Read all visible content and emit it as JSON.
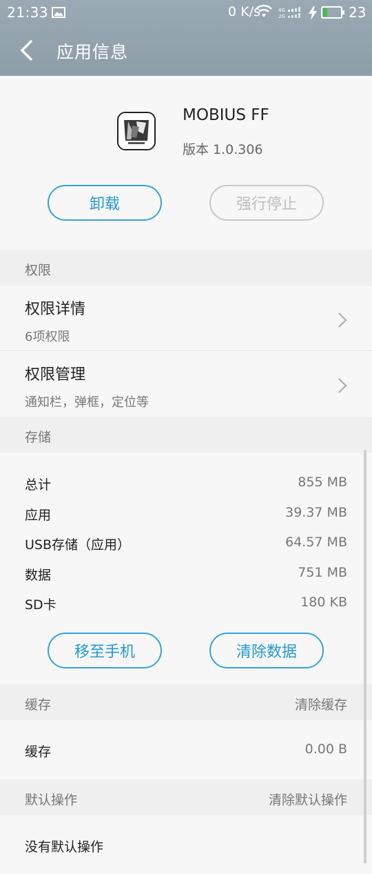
{
  "status_bar": {
    "time": "21:33",
    "net_speed": "0 K/s",
    "battery_level": "23",
    "battery_fraction": 0.23,
    "signal_labels": [
      "4G",
      "2G"
    ]
  },
  "title_bar": {
    "title": "应用信息"
  },
  "app": {
    "name": "MOBIUS FF",
    "version": "版本 1.0.306",
    "uninstall_label": "卸载",
    "force_stop_label": "强行停止"
  },
  "permissions": {
    "header": "权限",
    "items": [
      {
        "title": "权限详情",
        "subtitle": "6项权限"
      },
      {
        "title": "权限管理",
        "subtitle": "通知栏，弹框，定位等"
      }
    ]
  },
  "storage": {
    "header": "存储",
    "rows": [
      {
        "label": "总计",
        "value": "855 MB"
      },
      {
        "label": "应用",
        "value": "39.37 MB"
      },
      {
        "label": "USB存储（应用）",
        "value": "64.57 MB"
      },
      {
        "label": "数据",
        "value": "751 MB"
      },
      {
        "label": "SD卡",
        "value": "180 KB"
      }
    ],
    "move_label": "移至手机",
    "clear_data_label": "清除数据"
  },
  "cache": {
    "header": "缓存",
    "action": "清除缓存",
    "row": {
      "label": "缓存",
      "value": "0.00 B"
    }
  },
  "defaults": {
    "header": "默认操作",
    "action": "清除默认操作",
    "row": {
      "label": "没有默认操作"
    }
  },
  "colors": {
    "accent": "#2299d0",
    "top_bar": "#9aa9b3",
    "battery_fill": "#3cc24a"
  }
}
